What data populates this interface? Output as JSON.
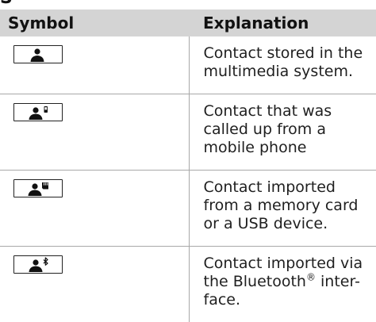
{
  "table": {
    "headers": {
      "symbol": "Symbol",
      "explanation": "Explanation"
    },
    "rows": [
      {
        "icon": "contact-icon",
        "explanation": "Contact stored in the multimedia system."
      },
      {
        "icon": "contact-mobile-phone-icon",
        "explanation": "Contact that was called up from a mobile phone"
      },
      {
        "icon": "contact-memory-card-icon",
        "explanation": "Contact imported from a memory card or a USB device."
      },
      {
        "icon": "contact-bluetooth-icon",
        "explanation_before": "Contact imported via the Bluetooth",
        "registered_mark": "®",
        "explanation_after": " inter- face."
      }
    ]
  }
}
